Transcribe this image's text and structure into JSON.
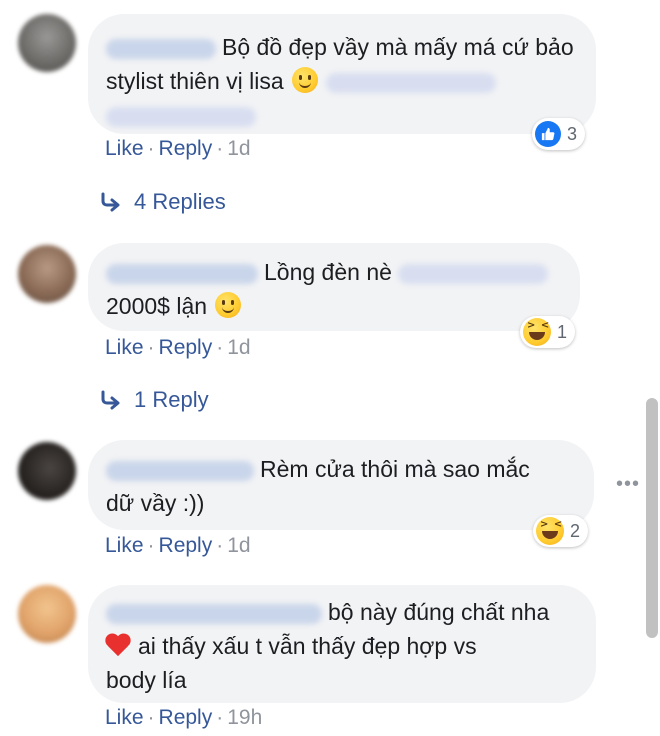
{
  "comments": [
    {
      "text": "Bộ đồ đẹp vầy mà mấy má cứ bảo stylist thiên vị lisa",
      "emoji": "smiling-face",
      "reaction": {
        "type": "like",
        "count": "3"
      },
      "like_label": "Like",
      "reply_label": "Reply",
      "time": "1d",
      "replies_label": "4 Replies",
      "avatar_color": "#6f6d6a"
    },
    {
      "text_line1": "Lồng đèn nè",
      "text_line2": "2000$ lận",
      "emoji": "smiling-face",
      "reaction": {
        "type": "haha",
        "count": "1"
      },
      "like_label": "Like",
      "reply_label": "Reply",
      "time": "1d",
      "replies_label": "1 Reply",
      "avatar_color": "#8a6a55"
    },
    {
      "text_line1": "Rèm cửa thôi mà sao mắc",
      "text_line2": "dữ vầy :))",
      "reaction": {
        "type": "haha",
        "count": "2"
      },
      "like_label": "Like",
      "reply_label": "Reply",
      "time": "1d",
      "avatar_color": "#2a2624"
    },
    {
      "text_line1": "bộ này đúng chất nha",
      "text_line2": "ai thấy xấu t vẫn thấy đẹp hợp vs",
      "text_line3": "body lía",
      "emoji": "red-heart",
      "like_label": "Like",
      "reply_label": "Reply",
      "time": "19h",
      "avatar_color": "#e0a36a"
    }
  ],
  "more_options_label": "•••",
  "colors": {
    "bubble": "#f2f3f5",
    "link": "#365899",
    "meta": "#90949c",
    "like_blue": "#1877f2"
  }
}
